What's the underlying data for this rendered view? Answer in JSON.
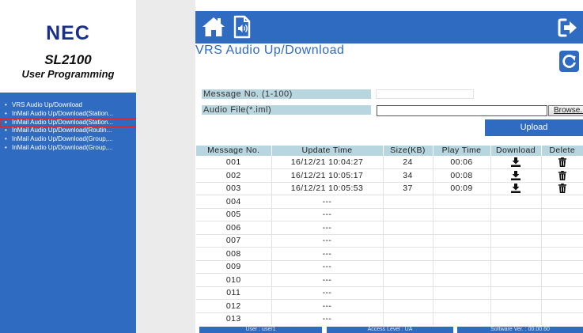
{
  "sidebar": {
    "logo": "NEC",
    "product": "SL2100",
    "subtitle": "User Programming",
    "items": [
      {
        "label": "VRS Audio Up/Download"
      },
      {
        "label": "InMail Audio Up/Download(Station..."
      },
      {
        "label": "InMail Audio Up/Download(Station..."
      },
      {
        "label": "InMail Audio Up/Download(Routin..."
      },
      {
        "label": "InMail Audio Up/Download(Group,..."
      },
      {
        "label": "InMail Audio Up/Download(Group,..."
      }
    ],
    "selected_index": 2
  },
  "header": {
    "icons": [
      "home-icon",
      "audio-file-icon",
      "logout-icon"
    ]
  },
  "page": {
    "title": "VRS Audio Up/Download",
    "refresh_icon": "refresh-icon"
  },
  "form": {
    "message_label": "Message No. (1-100)",
    "message_value": "",
    "file_label": "Audio File(*.iml)",
    "file_value": "",
    "browse_label": "Browse...",
    "upload_label": "Upload"
  },
  "table": {
    "headers": [
      "Message No.",
      "Update Time",
      "Size(KB)",
      "Play Time",
      "Download",
      "Delete"
    ],
    "rows": [
      {
        "no": "001",
        "time": "16/12/21 10:04:27",
        "size": "24",
        "play": "00:06",
        "has_file": true
      },
      {
        "no": "002",
        "time": "16/12/21 10:05:17",
        "size": "34",
        "play": "00:08",
        "has_file": true
      },
      {
        "no": "003",
        "time": "16/12/21 10:05:53",
        "size": "37",
        "play": "00:09",
        "has_file": true
      },
      {
        "no": "004",
        "time": "---",
        "size": "",
        "play": "",
        "has_file": false
      },
      {
        "no": "005",
        "time": "---",
        "size": "",
        "play": "",
        "has_file": false
      },
      {
        "no": "006",
        "time": "---",
        "size": "",
        "play": "",
        "has_file": false
      },
      {
        "no": "007",
        "time": "---",
        "size": "",
        "play": "",
        "has_file": false
      },
      {
        "no": "008",
        "time": "---",
        "size": "",
        "play": "",
        "has_file": false
      },
      {
        "no": "009",
        "time": "---",
        "size": "",
        "play": "",
        "has_file": false
      },
      {
        "no": "010",
        "time": "---",
        "size": "",
        "play": "",
        "has_file": false
      },
      {
        "no": "011",
        "time": "---",
        "size": "",
        "play": "",
        "has_file": false
      },
      {
        "no": "012",
        "time": "---",
        "size": "",
        "play": "",
        "has_file": false
      },
      {
        "no": "013",
        "time": "---",
        "size": "",
        "play": "",
        "has_file": false
      }
    ]
  },
  "footer": {
    "user": "User : user1",
    "access": "Access Level : UA",
    "software": "Software Ver. : 00.00.60"
  },
  "colors": {
    "primary_blue": "#2f6bc1",
    "header_cell": "#b7d6e0",
    "logo": "#1a2f8a",
    "selection_outline": "#e0282a",
    "gutter": "#ebebeb"
  }
}
